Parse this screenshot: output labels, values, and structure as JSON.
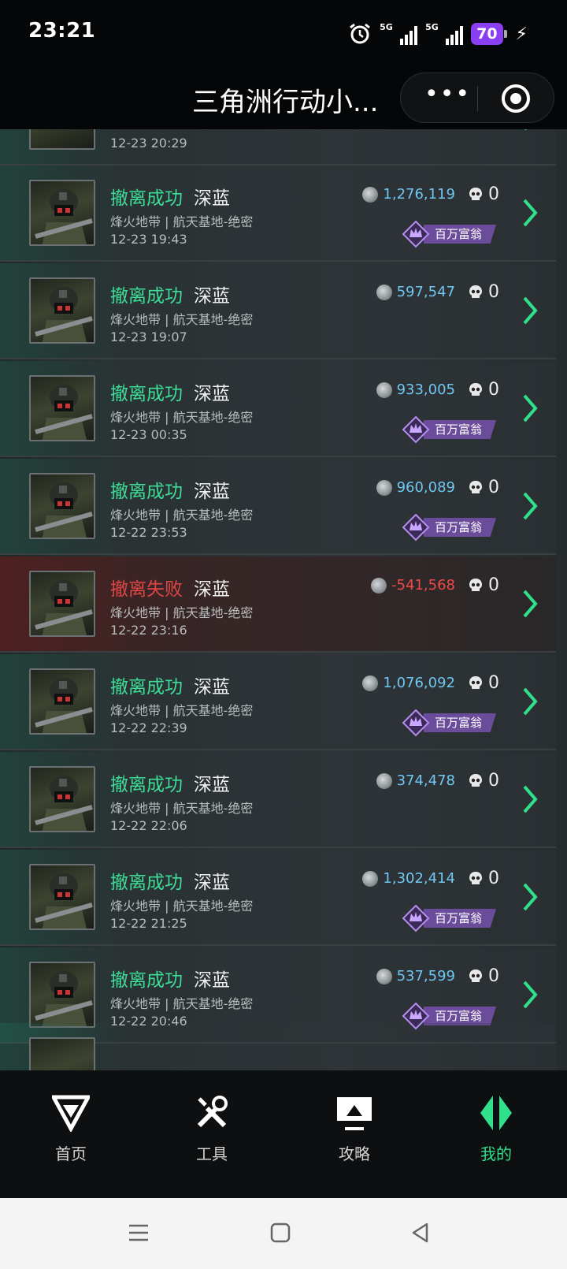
{
  "status_bar": {
    "time": "23:21",
    "battery": "70",
    "network_1": "5G",
    "network_2": "5G"
  },
  "header": {
    "title": "三角洲行动小..."
  },
  "partial_row_date": "12-23 20:29",
  "rows": [
    {
      "status": "撤离成功",
      "result": "ok",
      "mode": "深蓝",
      "map": "烽火地带 | 航天基地-绝密",
      "date": "12-23 19:43",
      "value": "1,276,119",
      "kills": "0",
      "badge": "百万富翁"
    },
    {
      "status": "撤离成功",
      "result": "ok",
      "mode": "深蓝",
      "map": "烽火地带 | 航天基地-绝密",
      "date": "12-23 19:07",
      "value": "597,547",
      "kills": "0",
      "badge": ""
    },
    {
      "status": "撤离成功",
      "result": "ok",
      "mode": "深蓝",
      "map": "烽火地带 | 航天基地-绝密",
      "date": "12-23 00:35",
      "value": "933,005",
      "kills": "0",
      "badge": "百万富翁"
    },
    {
      "status": "撤离成功",
      "result": "ok",
      "mode": "深蓝",
      "map": "烽火地带 | 航天基地-绝密",
      "date": "12-22 23:53",
      "value": "960,089",
      "kills": "0",
      "badge": "百万富翁"
    },
    {
      "status": "撤离失败",
      "result": "fail",
      "mode": "深蓝",
      "map": "烽火地带 | 航天基地-绝密",
      "date": "12-22 23:16",
      "value": "-541,568",
      "kills": "0",
      "badge": ""
    },
    {
      "status": "撤离成功",
      "result": "ok",
      "mode": "深蓝",
      "map": "烽火地带 | 航天基地-绝密",
      "date": "12-22 22:39",
      "value": "1,076,092",
      "kills": "0",
      "badge": "百万富翁"
    },
    {
      "status": "撤离成功",
      "result": "ok",
      "mode": "深蓝",
      "map": "烽火地带 | 航天基地-绝密",
      "date": "12-22 22:06",
      "value": "374,478",
      "kills": "0",
      "badge": ""
    },
    {
      "status": "撤离成功",
      "result": "ok",
      "mode": "深蓝",
      "map": "烽火地带 | 航天基地-绝密",
      "date": "12-22 21:25",
      "value": "1,302,414",
      "kills": "0",
      "badge": "百万富翁"
    },
    {
      "status": "撤离成功",
      "result": "ok",
      "mode": "深蓝",
      "map": "烽火地带 | 航天基地-绝密",
      "date": "12-22 20:46",
      "value": "537,599",
      "kills": "0",
      "badge": "百万富翁"
    }
  ],
  "tabs": [
    {
      "label": "首页",
      "icon": "home-logo-icon",
      "active": false
    },
    {
      "label": "工具",
      "icon": "tools-icon",
      "active": false
    },
    {
      "label": "攻略",
      "icon": "guide-icon",
      "active": false
    },
    {
      "label": "我的",
      "icon": "profile-icon",
      "active": true
    }
  ],
  "colors": {
    "success": "#3ddc97",
    "fail": "#e04545",
    "value": "#6fc8f2",
    "active_tab": "#30e08a",
    "badge": "#6b4c9a"
  }
}
